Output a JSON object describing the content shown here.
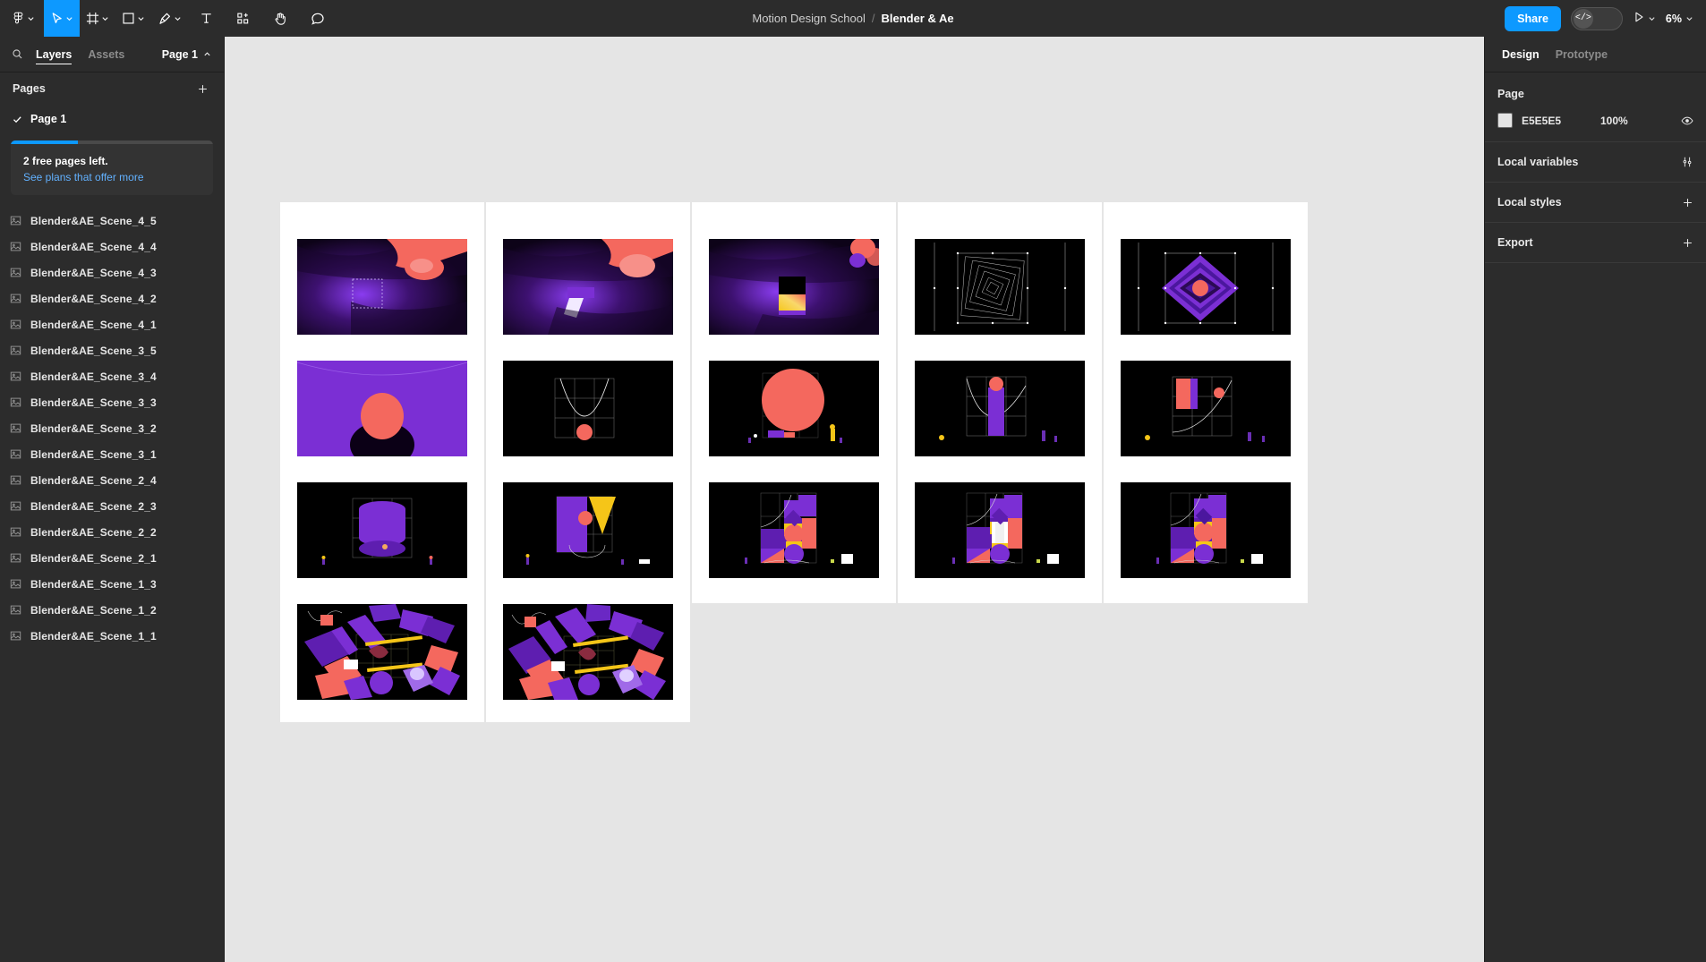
{
  "topbar": {
    "main_menu_icon": "figma-logo-icon",
    "tools": [
      {
        "name": "move-tool",
        "icon": "cursor-icon",
        "active": true,
        "has_chevron": true
      },
      {
        "name": "frame-tool",
        "icon": "frame-icon",
        "active": false,
        "has_chevron": true
      },
      {
        "name": "shape-tool",
        "icon": "square-icon",
        "active": false,
        "has_chevron": true
      },
      {
        "name": "pen-tool",
        "icon": "pen-icon",
        "active": false,
        "has_chevron": true
      },
      {
        "name": "text-tool",
        "icon": "text-icon",
        "active": false,
        "has_chevron": false
      },
      {
        "name": "components-tool",
        "icon": "components-icon",
        "active": false,
        "has_chevron": false
      },
      {
        "name": "hand-tool",
        "icon": "hand-icon",
        "active": false,
        "has_chevron": false
      },
      {
        "name": "comment-tool",
        "icon": "comment-icon",
        "active": false,
        "has_chevron": false
      }
    ],
    "breadcrumb_team": "Motion Design School",
    "breadcrumb_separator": "/",
    "breadcrumb_file": "Blender & Ae",
    "share_label": "Share",
    "devmode_label": "</>",
    "present_icon": "play-icon",
    "zoom_level": "6%"
  },
  "left_panel": {
    "search_icon": "search-icon",
    "tabs": [
      {
        "label": "Layers",
        "active": true
      },
      {
        "label": "Assets",
        "active": false
      }
    ],
    "page_selector": "Page 1",
    "pages_header": "Pages",
    "add_page_icon": "plus-icon",
    "current_page": "Page 1",
    "promo": {
      "progress_pct": 33,
      "title": "2 free pages left.",
      "link": "See plans that offer more"
    },
    "layers": [
      "Blender&AE_Scene_4_5",
      "Blender&AE_Scene_4_4",
      "Blender&AE_Scene_4_3",
      "Blender&AE_Scene_4_2",
      "Blender&AE_Scene_4_1",
      "Blender&AE_Scene_3_5",
      "Blender&AE_Scene_3_4",
      "Blender&AE_Scene_3_3",
      "Blender&AE_Scene_3_2",
      "Blender&AE_Scene_3_1",
      "Blender&AE_Scene_2_4",
      "Blender&AE_Scene_2_3",
      "Blender&AE_Scene_2_2",
      "Blender&AE_Scene_2_1",
      "Blender&AE_Scene_1_3",
      "Blender&AE_Scene_1_2",
      "Blender&AE_Scene_1_1"
    ]
  },
  "right_panel": {
    "tabs": [
      {
        "label": "Design",
        "active": true
      },
      {
        "label": "Prototype",
        "active": false
      }
    ],
    "page_section": {
      "title": "Page",
      "background_hex": "E5E5E5",
      "background_swatch": "#E5E5E5",
      "opacity": "100%",
      "visibility_icon": "eye-icon"
    },
    "local_variables": {
      "title": "Local variables",
      "icon": "sliders-icon"
    },
    "local_styles": {
      "title": "Local styles",
      "icon": "plus-icon"
    },
    "export": {
      "title": "Export",
      "icon": "plus-icon"
    }
  },
  "canvas": {
    "background": "#E5E5E5",
    "columns": [
      {
        "name": "scene-column-1",
        "thumbnails": [
          "nebula-hand-select",
          "purple-blob-circle",
          "purple-stack-grid",
          "scattered-blocks-a"
        ]
      },
      {
        "name": "scene-column-2",
        "thumbnails": [
          "nebula-hand-swipe",
          "parabola-grid-ball",
          "cone-grid-ball",
          "scattered-blocks-b"
        ]
      },
      {
        "name": "scene-column-3",
        "thumbnails": [
          "nebula-gradient-box",
          "big-coral-circle",
          "composite-shapes-a"
        ]
      },
      {
        "name": "scene-column-4",
        "thumbnails": [
          "wireframe-squares",
          "purple-bar-curve",
          "composite-shapes-b"
        ]
      },
      {
        "name": "scene-column-5",
        "thumbnails": [
          "purple-diamond",
          "coral-bar-curve",
          "composite-shapes-c"
        ]
      }
    ],
    "palette": {
      "purple": "#7B2FD4",
      "deep_purple": "#4B179E",
      "coral": "#F4685E",
      "yellow": "#F5C518",
      "black": "#000000"
    }
  }
}
